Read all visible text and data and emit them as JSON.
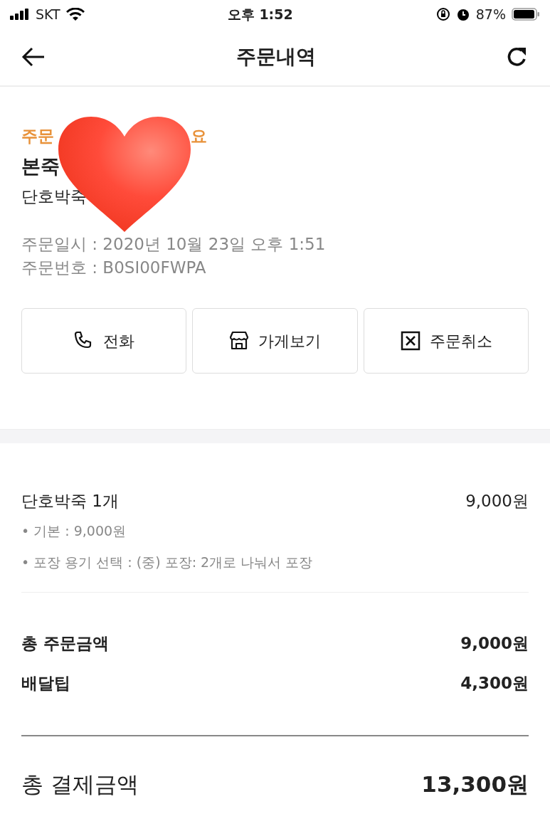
{
  "status_bar": {
    "carrier": "SKT",
    "time": "오후 1:52",
    "battery": "87%"
  },
  "header": {
    "title": "주문내역"
  },
  "order": {
    "status_visible_start": "주문",
    "status_visible_end": "요",
    "store_visible": "본죽",
    "menu_visible": "단호박죽",
    "date": "주문일시 : 2020년 10월 23일 오후 1:51",
    "number": "주문번호 : B0SI00FWPA"
  },
  "actions": [
    {
      "kind": "phone",
      "label": "전화"
    },
    {
      "kind": "store",
      "label": "가게보기"
    },
    {
      "kind": "cancel",
      "label": "주문취소"
    }
  ],
  "items": [
    {
      "name": "단호박죽 1개",
      "price": "9,000원",
      "options": [
        "• 기본 : 9,000원",
        "• 포장 용기 선택 : (중) 포장: 2개로 나눠서 포장"
      ]
    }
  ],
  "summary": [
    {
      "label": "총 주문금액",
      "value": "9,000원"
    },
    {
      "label": "배달팁",
      "value": "4,300원"
    }
  ],
  "total": {
    "label": "총 결제금액",
    "value": "13,300원"
  }
}
